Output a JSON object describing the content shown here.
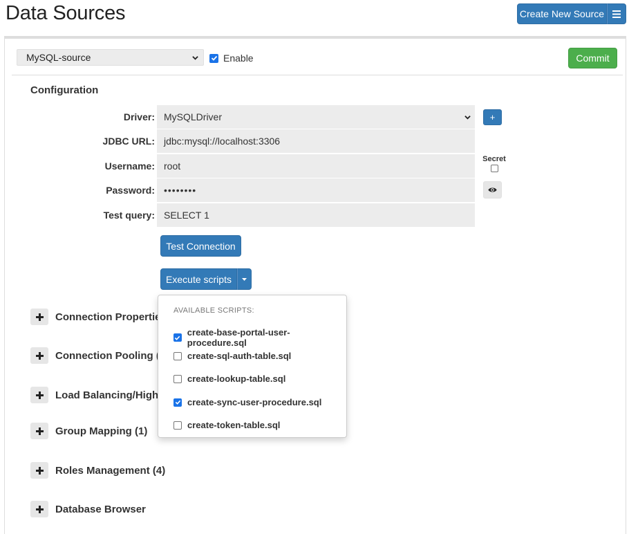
{
  "page": {
    "title": "Data Sources"
  },
  "toolbar": {
    "create_label": "Create New Source"
  },
  "source": {
    "selected": "MySQL-source",
    "enable_label": "Enable",
    "enabled": true
  },
  "commit_label": "Commit",
  "config": {
    "title": "Configuration",
    "driver": {
      "label": "Driver:",
      "value": "MySQLDriver"
    },
    "jdbc": {
      "label": "JDBC URL:",
      "value": "jdbc:mysql://localhost:3306"
    },
    "username": {
      "label": "Username:",
      "value": "root"
    },
    "password": {
      "label": "Password:",
      "value": "••••••••"
    },
    "test_query": {
      "label": "Test query:",
      "value": "SELECT 1"
    },
    "add_driver_label": "+",
    "secret_label": "Secret",
    "test_connection_label": "Test Connection",
    "execute_scripts_label": "Execute scripts"
  },
  "sections": [
    {
      "label": "Connection Properties"
    },
    {
      "label": "Connection Pooling (En"
    },
    {
      "label": "Load Balancing/High Av"
    },
    {
      "label": "Group Mapping (1)"
    },
    {
      "label": "Roles Management (4)"
    },
    {
      "label": "Database Browser"
    }
  ],
  "scripts_dropdown": {
    "header": "AVAILABLE SCRIPTS:",
    "items": [
      {
        "label": "create-base-portal-user-procedure.sql",
        "checked": true
      },
      {
        "label": "create-sql-auth-table.sql",
        "checked": false
      },
      {
        "label": "create-lookup-table.sql",
        "checked": false
      },
      {
        "label": "create-sync-user-procedure.sql",
        "checked": true
      },
      {
        "label": "create-token-table.sql",
        "checked": false
      }
    ]
  },
  "colors": {
    "primary": "#337ab7",
    "success": "#4cae4c",
    "field_bg": "#ececec",
    "checkbox": "#1a73e8"
  },
  "icons": [
    "hamburger-icon",
    "chevron-down-icon",
    "plus-icon",
    "eye-icon",
    "caret-down-icon",
    "check-icon"
  ]
}
